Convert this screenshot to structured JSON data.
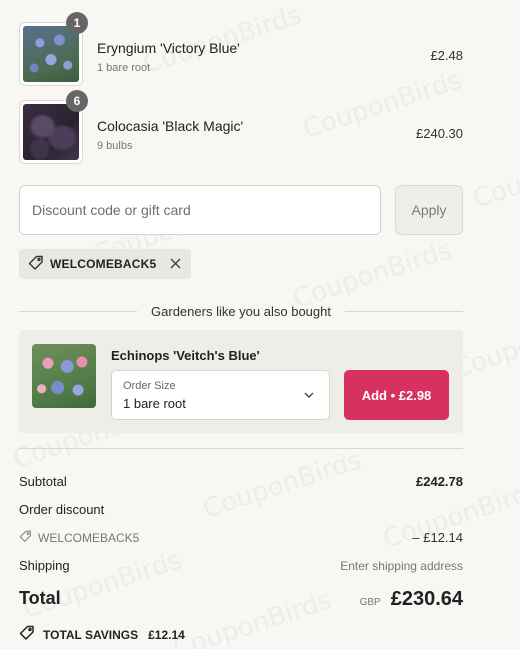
{
  "line_items": [
    {
      "quantity": "1",
      "name": "Eryngium 'Victory Blue'",
      "variant": "1 bare root",
      "price": "£2.48",
      "image": "eryngium-flower-photo"
    },
    {
      "quantity": "6",
      "name": "Colocasia 'Black Magic'",
      "variant": "9 bulbs",
      "price": "£240.30",
      "image": "colocasia-leaf-photo"
    }
  ],
  "discount": {
    "placeholder": "Discount code or gift card",
    "value": "",
    "apply_label": "Apply",
    "applied_code": "WELCOMEBACK5",
    "tag_icon": "tag-icon",
    "remove_icon": "close-icon"
  },
  "upsell": {
    "heading": "Gardeners like you also bought",
    "product_name": "Echinops 'Veitch's Blue'",
    "image": "echinops-flower-photo",
    "select_label": "Order Size",
    "select_value": "1 bare root",
    "add_label": "Add • £2.98"
  },
  "summary": {
    "subtotal_label": "Subtotal",
    "subtotal_value": "£242.78",
    "order_discount_label": "Order discount",
    "discount_code": "WELCOMEBACK5",
    "discount_value": "– £12.14",
    "shipping_label": "Shipping",
    "shipping_value": "Enter shipping address",
    "total_label": "Total",
    "currency": "GBP",
    "total_value": "£230.64",
    "savings_label": "TOTAL SAVINGS",
    "savings_value": "£12.14"
  },
  "watermark": "CouponBirds",
  "colors": {
    "accent": "#d7325f",
    "background": "#f8f7f4",
    "badge": "#666666"
  }
}
